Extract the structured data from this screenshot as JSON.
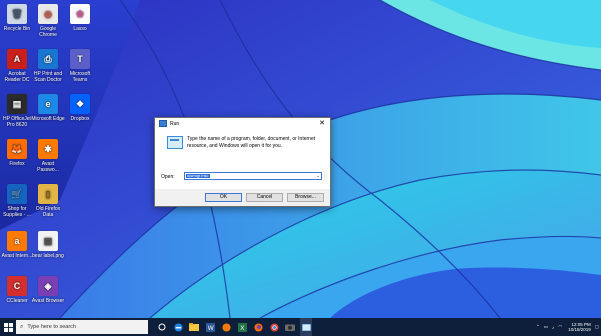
{
  "desktop": {
    "icons": [
      {
        "label": "Recycle Bin",
        "color": "#cfd8e6",
        "glyph": "🗑"
      },
      {
        "label": "Google Chrome",
        "color": "#e9e9e9",
        "glyph": "◎"
      },
      {
        "label": "Lasso",
        "color": "#ffffff",
        "glyph": "✿"
      },
      {
        "label": "Acrobat Reader DC",
        "color": "#c9201b",
        "glyph": "A"
      },
      {
        "label": "HP Print and Scan Doctor",
        "color": "#1976d2",
        "glyph": "⎙"
      },
      {
        "label": "Microsoft Teams",
        "color": "#5b5fc7",
        "glyph": "T"
      },
      {
        "label": "HP OfficeJet Pro 8620",
        "color": "#2b2b2b",
        "glyph": "▤"
      },
      {
        "label": "Microsoft Edge",
        "color": "#1e88e5",
        "glyph": "e"
      },
      {
        "label": "Dropbox",
        "color": "#0061ff",
        "glyph": "❖"
      },
      {
        "label": "Firefox",
        "color": "#ff6d00",
        "glyph": "🦊"
      },
      {
        "label": "Avast Passwo...",
        "color": "#ff7a00",
        "glyph": "✱"
      },
      {
        "label": "Shop for Supplies - ...",
        "color": "#1565c0",
        "glyph": "🛒"
      },
      {
        "label": "Old Firefox Data",
        "color": "#e0b446",
        "glyph": "▯"
      },
      {
        "label": "Avast Intern...",
        "color": "#ff7a00",
        "glyph": "a"
      },
      {
        "label": "bear label.png",
        "color": "#f3f3f3",
        "glyph": "▦"
      },
      {
        "label": "CCleaner",
        "color": "#d32f2f",
        "glyph": "C"
      },
      {
        "label": "Avast Browser",
        "color": "#7b3fb5",
        "glyph": "◈"
      }
    ]
  },
  "run_dialog": {
    "title": "Run",
    "close_glyph": "✕",
    "description": "Type the name of a program, folder, document, or Internet resource, and Windows will open it for you.",
    "open_label": "Open:",
    "open_value": "lusrmgr.msc",
    "ok_label": "OK",
    "cancel_label": "Cancel",
    "browse_label": "Browse..."
  },
  "taskbar": {
    "search_placeholder": "Type here to search",
    "time": "12:05 PM",
    "date": "10/18/2019",
    "apps": [
      "task-view",
      "edge",
      "file-explorer",
      "word",
      "avast",
      "excel",
      "firefox",
      "chrome",
      "camera",
      "run"
    ]
  }
}
